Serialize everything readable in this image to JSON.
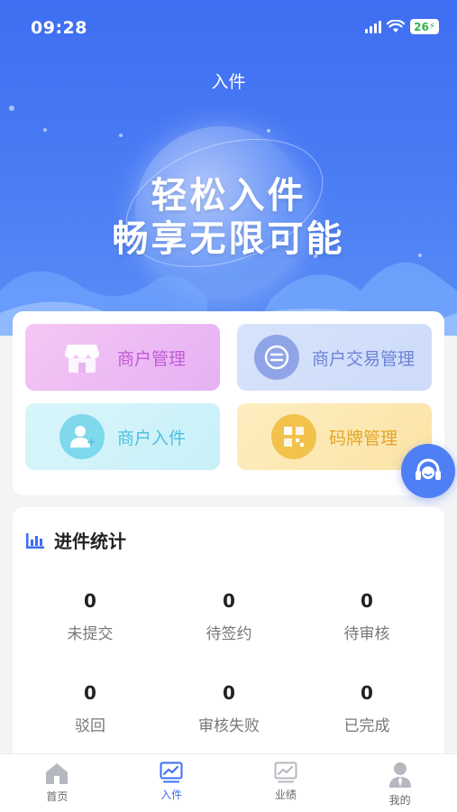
{
  "status_bar": {
    "time": "09:28",
    "battery": "26"
  },
  "nav": {
    "title": "入件"
  },
  "hero": {
    "slogan_line1": "轻松入件",
    "slogan_line2": "畅享无限可能"
  },
  "menu": [
    {
      "label": "商户管理",
      "icon": "store-icon"
    },
    {
      "label": "商户交易管理",
      "icon": "transaction-icon"
    },
    {
      "label": "商户入件",
      "icon": "add-user-icon"
    },
    {
      "label": "码牌管理",
      "icon": "qr-board-icon"
    }
  ],
  "stats": {
    "title": "进件统计",
    "items": [
      {
        "value": "0",
        "label": "未提交"
      },
      {
        "value": "0",
        "label": "待签约"
      },
      {
        "value": "0",
        "label": "待审核"
      },
      {
        "value": "0",
        "label": "驳回"
      },
      {
        "value": "0",
        "label": "审核失败"
      },
      {
        "value": "0",
        "label": "已完成"
      }
    ]
  },
  "tabs": [
    {
      "label": "首页",
      "icon": "home-icon"
    },
    {
      "label": "入件",
      "icon": "chart-icon"
    },
    {
      "label": "业绩",
      "icon": "performance-icon"
    },
    {
      "label": "我的",
      "icon": "profile-icon"
    }
  ],
  "colors": {
    "primary": "#3d6ef2",
    "tab_active": "#3d6ef2"
  }
}
